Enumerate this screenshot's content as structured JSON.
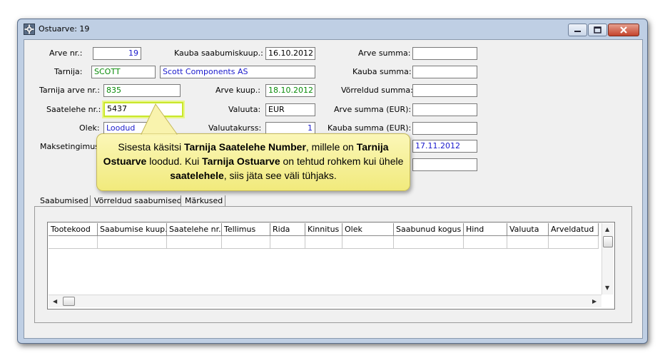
{
  "window": {
    "title": "Ostuarve: 19"
  },
  "form": {
    "arve_nr_label": "Arve nr.:",
    "arve_nr_value": "19",
    "tarnija_label": "Tarnija:",
    "tarnija_code": "SCOTT",
    "tarnija_name": "Scott Components AS",
    "tarnija_arve_nr_label": "Tarnija arve nr.:",
    "tarnija_arve_nr_value": "835",
    "saatelehe_nr_label": "Saatelehe nr.:",
    "saatelehe_nr_value": "5437",
    "olek_label": "Olek:",
    "olek_value": "Loodud",
    "maksetingimus_label": "Maksetingimus",
    "kauba_saabumiskuup_label": "Kauba saabumiskuup.:",
    "kauba_saabumiskuup_value": "16.10.2012",
    "arve_kuup_label": "Arve kuup.:",
    "arve_kuup_value": "18.10.2012",
    "valuuta_label": "Valuuta:",
    "valuuta_value": "EUR",
    "valuutakurss_label": "Valuutakurss:",
    "valuutakurss_value": "1",
    "arve_summa_label": "Arve summa:",
    "kauba_summa_label": "Kauba summa:",
    "vorreldud_summa_label": "Võrreldud summa:",
    "arve_summa_eur_label": "Arve summa (EUR):",
    "kauba_summa_eur_label": "Kauba summa (EUR):",
    "tahtaeg_value": "17.11.2012"
  },
  "tabs": [
    {
      "label": "Saabumised"
    },
    {
      "label": "Võrreldud saabumised"
    },
    {
      "label": "Märkused"
    }
  ],
  "grid": {
    "columns": [
      "Tootekood",
      "Saabumise kuup.",
      "Saatelehe nr.",
      "Tellimus",
      "Rida",
      "Kinnitus",
      "Olek",
      "Saabunud kogus",
      "Hind",
      "Valuuta",
      "Arveldatud"
    ]
  },
  "callout": {
    "parts": [
      {
        "text": "Sisesta käsitsi ",
        "bold": false
      },
      {
        "text": "Tarnija Saatelehe Number",
        "bold": true
      },
      {
        "text": ", millele on ",
        "bold": false
      },
      {
        "text": "Tarnija Ostuarve",
        "bold": true
      },
      {
        "text": " loodud. Kui ",
        "bold": false
      },
      {
        "text": "Tarnija Ostuarve",
        "bold": true
      },
      {
        "text": " on tehtud rohkem kui ühele ",
        "bold": false
      },
      {
        "text": "saatelehele",
        "bold": true
      },
      {
        "text": ", siis jäta see väli tühjaks.",
        "bold": false
      }
    ]
  },
  "colors": {
    "window_frame": "#bfcfe4",
    "client_bg": "#f0f0f0",
    "green_text": "#0a8c0a",
    "blue_text": "#1a1acc",
    "callout_bg": "#f6ef9a",
    "highlight": "#c9e72a",
    "close_button": "#c4432c"
  },
  "icons": {
    "title": "gear-grid-icon",
    "minimize": "minimize-icon",
    "maximize": "maximize-icon",
    "close": "close-icon"
  }
}
